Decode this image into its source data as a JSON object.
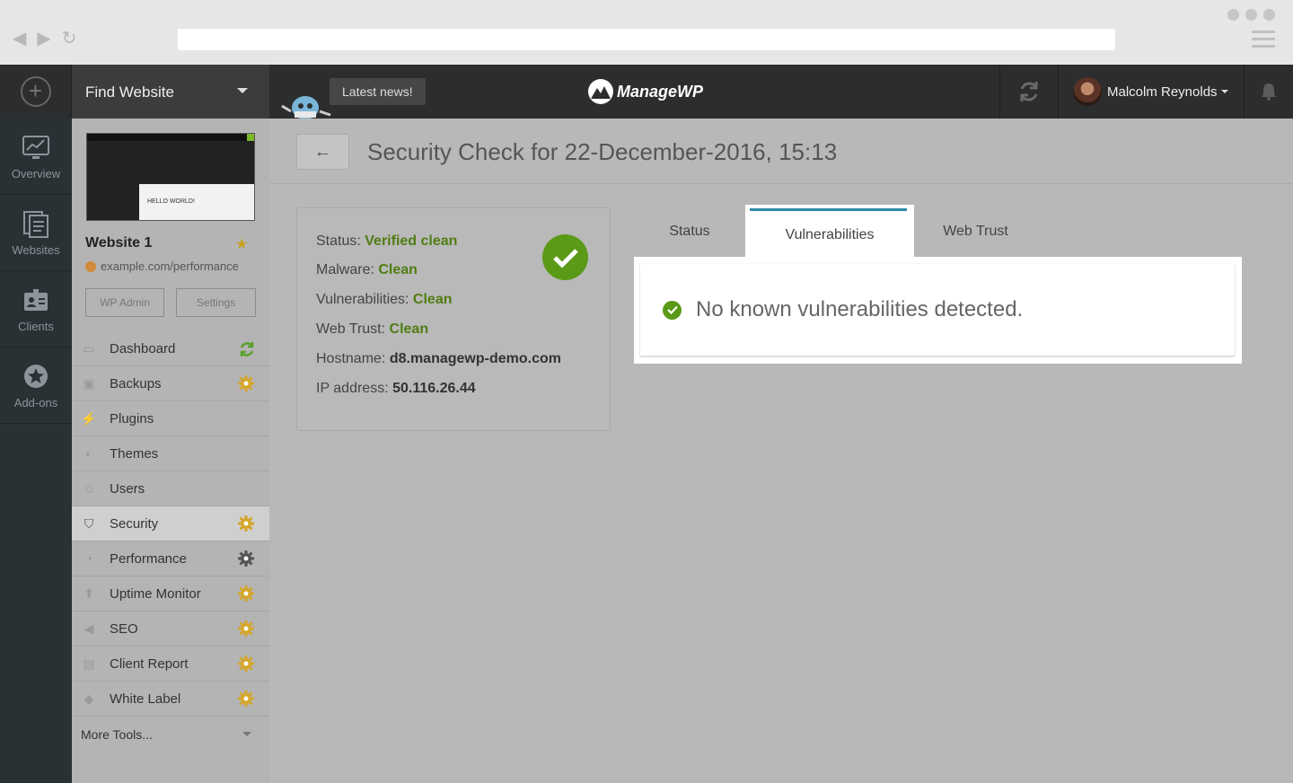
{
  "colors": {
    "accent_green": "#5a9a16",
    "tab_accent": "#2a8aa8",
    "rail_bg": "#283235",
    "topbar_bg": "#2b2d2e",
    "gear_gold": "#d4a62a",
    "gear_dark": "#555555",
    "refresh_green": "#5aa02a"
  },
  "topbar": {
    "find_website": "Find Website",
    "latest_news": "Latest news!",
    "logo_text": "ManageWP",
    "user_name": "Malcolm Reynolds"
  },
  "rail": [
    {
      "label": "Overview",
      "icon": "chart-monitor-icon"
    },
    {
      "label": "Websites",
      "icon": "pages-icon"
    },
    {
      "label": "Clients",
      "icon": "id-card-icon"
    },
    {
      "label": "Add-ons",
      "icon": "star-gear-icon"
    }
  ],
  "site": {
    "name": "Website 1",
    "url": "example.com/performance",
    "thumb_text": "HELLO WORLD!",
    "wp_admin": "WP Admin",
    "settings": "Settings"
  },
  "menu": [
    {
      "label": "Dashboard",
      "icon": "monitor-icon",
      "badge": "refresh"
    },
    {
      "label": "Backups",
      "icon": "backup-icon",
      "badge": "gear-gold"
    },
    {
      "label": "Plugins",
      "icon": "plug-icon",
      "badge": "none"
    },
    {
      "label": "Themes",
      "icon": "palette-icon",
      "badge": "none"
    },
    {
      "label": "Users",
      "icon": "users-icon",
      "badge": "none"
    },
    {
      "label": "Security",
      "icon": "shield-icon",
      "badge": "gear-gold",
      "active": true
    },
    {
      "label": "Performance",
      "icon": "gauge-icon",
      "badge": "gear-dark"
    },
    {
      "label": "Uptime Monitor",
      "icon": "arrow-up-icon",
      "badge": "gear-gold"
    },
    {
      "label": "SEO",
      "icon": "megaphone-icon",
      "badge": "gear-gold"
    },
    {
      "label": "Client Report",
      "icon": "report-icon",
      "badge": "gear-gold"
    },
    {
      "label": "White Label",
      "icon": "tag-icon",
      "badge": "gear-gold"
    }
  ],
  "more_tools": "More Tools...",
  "main": {
    "back_arrow": "←",
    "title": "Security Check for 22-December-2016, 15:13",
    "status": {
      "status_label": "Status:",
      "status_value": "Verified clean",
      "malware_label": "Malware:",
      "malware_value": "Clean",
      "vuln_label": "Vulnerabilities:",
      "vuln_value": "Clean",
      "webtrust_label": "Web Trust:",
      "webtrust_value": "Clean",
      "hostname_label": "Hostname:",
      "hostname_value": "d8.managewp-demo.com",
      "ip_label": "IP address:",
      "ip_value": "50.116.26.44"
    },
    "tabs": [
      "Status",
      "Vulnerabilities",
      "Web Trust"
    ],
    "active_tab": "Vulnerabilities",
    "message": "No known vulnerabilities detected."
  }
}
